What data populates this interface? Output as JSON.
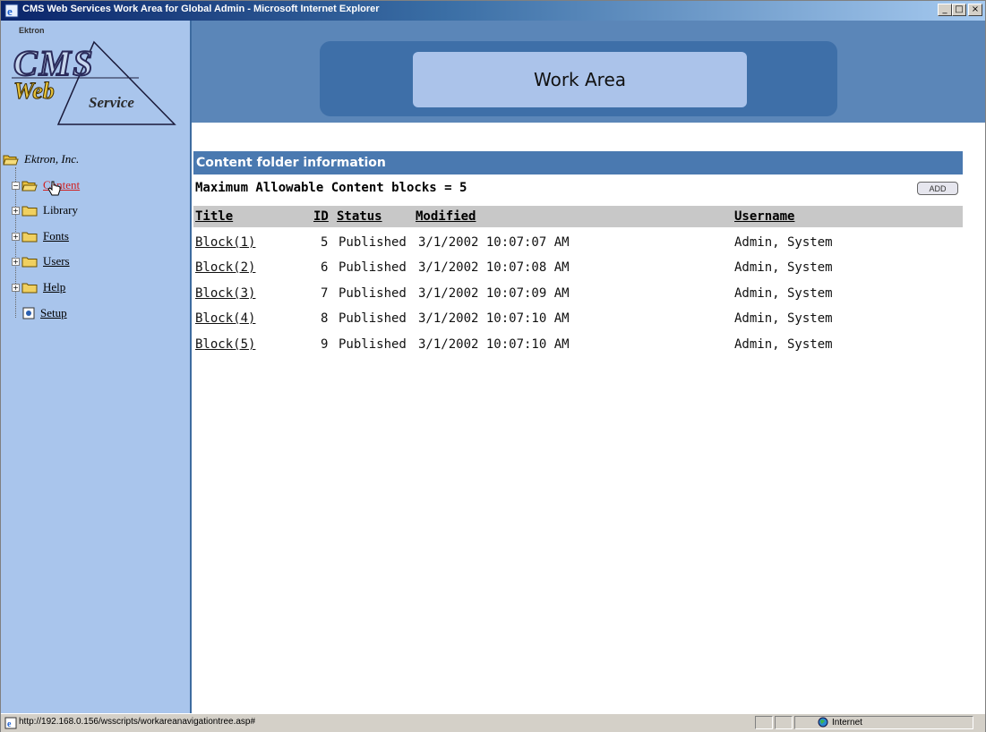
{
  "window": {
    "title": "CMS Web Services Work Area for Global Admin - Microsoft Internet Explorer",
    "controls": {
      "minimize": "_",
      "maximize": "□",
      "close": "×"
    }
  },
  "logo": {
    "brand": "Ektron",
    "cms": "CMS",
    "web": "Web",
    "service": "Service"
  },
  "header": {
    "title": "Work Area"
  },
  "tree": {
    "root": "Ektron, Inc.",
    "items": [
      {
        "label": "Content",
        "icon": "folder-open-icon",
        "expander": "−",
        "active": true
      },
      {
        "label": "Library",
        "icon": "folder-icon",
        "expander": "+"
      },
      {
        "label": "Fonts",
        "icon": "folder-icon",
        "expander": "+"
      },
      {
        "label": "Users",
        "icon": "folder-icon",
        "expander": "+"
      },
      {
        "label": "Help",
        "icon": "folder-icon",
        "expander": "+"
      },
      {
        "label": "Setup",
        "icon": "setup-document-icon",
        "expander": ""
      }
    ]
  },
  "content": {
    "section_title": "Content folder information",
    "max_blocks_text": "Maximum Allowable Content blocks = 5",
    "add_label": "ADD",
    "columns": {
      "title": "Title",
      "id": "ID",
      "status": "Status",
      "modified": "Modified",
      "username": "Username"
    },
    "rows": [
      {
        "title": "Block(1)",
        "id": "5",
        "status": "Published",
        "modified": "3/1/2002 10:07:07 AM",
        "username": "Admin, System"
      },
      {
        "title": "Block(2)",
        "id": "6",
        "status": "Published",
        "modified": "3/1/2002 10:07:08 AM",
        "username": "Admin, System"
      },
      {
        "title": "Block(3)",
        "id": "7",
        "status": "Published",
        "modified": "3/1/2002 10:07:09 AM",
        "username": "Admin, System"
      },
      {
        "title": "Block(4)",
        "id": "8",
        "status": "Published",
        "modified": "3/1/2002 10:07:10 AM",
        "username": "Admin, System"
      },
      {
        "title": "Block(5)",
        "id": "9",
        "status": "Published",
        "modified": "3/1/2002 10:07:10 AM",
        "username": "Admin, System"
      }
    ]
  },
  "statusbar": {
    "url": "http://192.168.0.156/wsscripts/workareanavigationtree.asp#",
    "zone": "Internet"
  },
  "colors": {
    "left_frame": "#a9c5ec",
    "header": "#5b86b8",
    "section_header": "#4a79b0",
    "column_header": "#c8c8c8",
    "active_link": "#d02020"
  }
}
